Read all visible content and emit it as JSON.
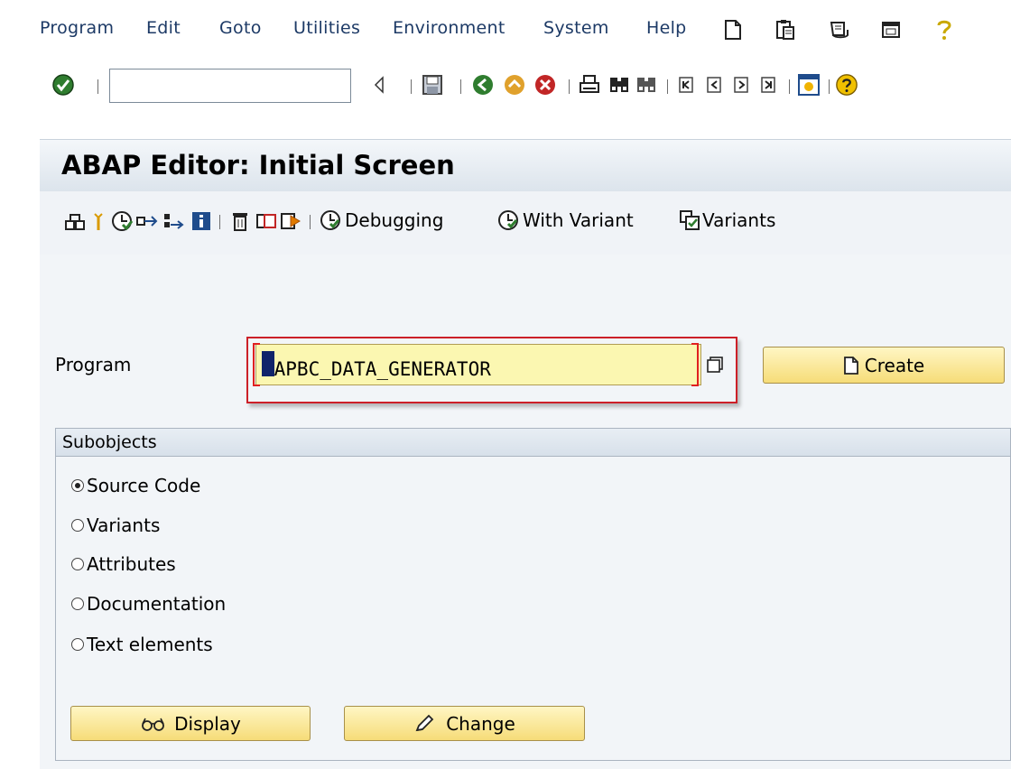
{
  "menu": {
    "items": [
      "Program",
      "Edit",
      "Goto",
      "Utilities",
      "Environment",
      "System",
      "Help"
    ],
    "icons": [
      "new-session-icon",
      "clipboard-icon",
      "script-icon",
      "window-icon",
      "help-question-icon"
    ]
  },
  "toolbar": {
    "command_value": "",
    "icons": [
      "enter-icon",
      "back-arrow-icon",
      "save-icon",
      "back-icon",
      "exit-icon",
      "cancel-icon",
      "print-icon",
      "find-icon",
      "find-next-icon",
      "first-page-icon",
      "previous-page-icon",
      "next-page-icon",
      "last-page-icon",
      "new-window-icon",
      "help-icon"
    ]
  },
  "title": "ABAP Editor: Initial Screen",
  "app_toolbar": {
    "icons": [
      "other-object-icon",
      "check-icon",
      "activate-icon",
      "where-used-icon",
      "test-icon",
      "info-icon",
      "delete-icon",
      "copy-icon",
      "rename-icon"
    ],
    "buttons": [
      {
        "icon": "execute-icon",
        "label": "Debugging"
      },
      {
        "icon": "execute-variant-icon",
        "label": "With Variant"
      },
      {
        "icon": "variants-icon",
        "label": "Variants"
      }
    ]
  },
  "program": {
    "label": "Program",
    "value": "SAPBC_DATA_GENERATOR",
    "create_label": "Create"
  },
  "subobjects": {
    "title": "Subobjects",
    "options": [
      {
        "label": "Source Code",
        "selected": true
      },
      {
        "label": "Variants",
        "selected": false
      },
      {
        "label": "Attributes",
        "selected": false
      },
      {
        "label": "Documentation",
        "selected": false
      },
      {
        "label": "Text elements",
        "selected": false
      }
    ]
  },
  "actions": {
    "display_label": "Display",
    "change_label": "Change"
  },
  "colors": {
    "accent_yellow": "#f6dc78",
    "input_yellow": "#fbf7b1",
    "highlight_red": "#cc2028",
    "menu_text": "#1d3a66"
  }
}
